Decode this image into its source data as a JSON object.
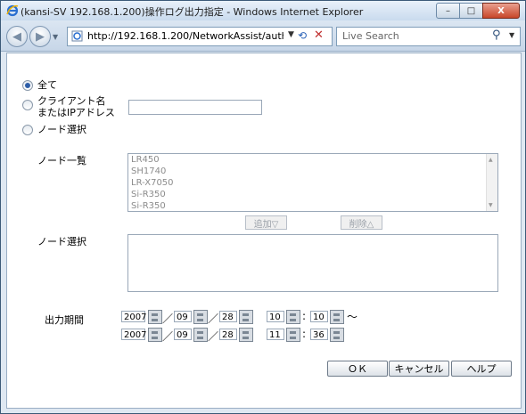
{
  "window": {
    "title": "(kansi-SV 192.168.1.200)操作ログ出力指定 - Windows Internet Explorer",
    "min_label": "–",
    "max_label": "□",
    "close_label": "X"
  },
  "browser": {
    "url": "http://192.168.1.200/NetworkAssist/auth",
    "search_placeholder": "Live Search"
  },
  "form": {
    "radio_all": "全て",
    "radio_client_line1": "クライアント名",
    "radio_client_line2": "またはIPアドレス",
    "radio_node": "ノード選択",
    "node_list_label": "ノード一覧",
    "node_list_items": [
      "LR450",
      "SH1740",
      "LR-X7050",
      "Si-R350",
      "Si-R350"
    ],
    "add_button": "追加▽",
    "delete_button": "削除△",
    "node_select_label": "ノード選択",
    "period_label": "出力期間",
    "start": {
      "year": "2007",
      "month": "09",
      "day": "28",
      "hour": "10",
      "minute": "10"
    },
    "end": {
      "year": "2007",
      "month": "09",
      "day": "28",
      "hour": "11",
      "minute": "36"
    },
    "date_sep": "／",
    "time_sep": ":",
    "range_sep": "～"
  },
  "actions": {
    "ok": "ＯＫ",
    "cancel": "キャンセル",
    "help": "ヘルプ"
  }
}
